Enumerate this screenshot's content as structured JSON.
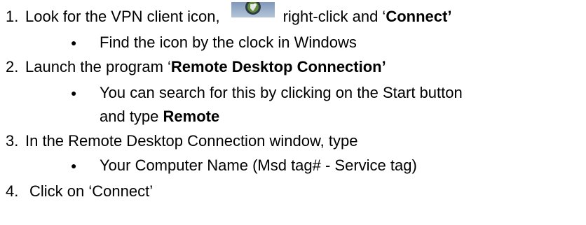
{
  "steps": [
    {
      "number": "1.",
      "text_before_icon": "Look for the VPN client icon,",
      "icon": "vpn-client-icon",
      "text_after_icon": "right-click and ‘",
      "bold": "Connect’",
      "bullets": [
        "Find the icon by the clock in Windows"
      ]
    },
    {
      "number": "2.",
      "text": "Launch the program ‘",
      "bold": "Remote Desktop Connection’",
      "bullet_line1": "You can search for this by clicking on the Start button",
      "bullet_line2_text": "and type ",
      "bullet_line2_bold": "Remote"
    },
    {
      "number": "3.",
      "text": "In the Remote Desktop Connection window, type",
      "bullets": [
        "Your Computer Name (Msd tag# - Service tag)"
      ]
    },
    {
      "number": "4.",
      "text": "Click on ‘Connect’"
    }
  ],
  "bullet_glyph": "●"
}
